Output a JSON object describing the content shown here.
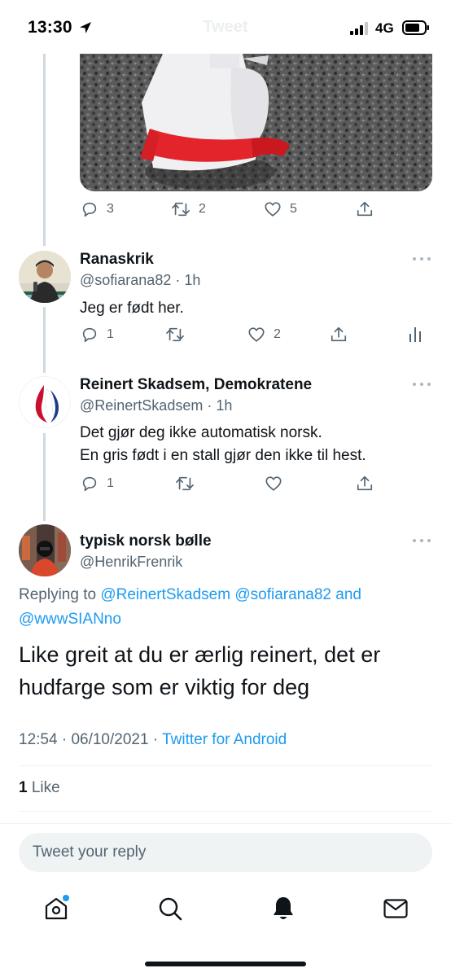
{
  "status_bar": {
    "time": "13:30",
    "network": "4G",
    "faded_title": "Tweet"
  },
  "colors": {
    "accent": "#1d9bf0",
    "text_primary": "#0f1419",
    "text_secondary": "#536471",
    "thread_line": "#cfd9de",
    "divider": "#eff3f4"
  },
  "parent_tweet": {
    "media_alt": "photo of a white megaphone with a red strap on gravel",
    "reply_count": "3",
    "retweet_count": "2",
    "like_count": "5",
    "icons": [
      "reply-icon",
      "retweet-icon",
      "like-icon",
      "share-icon"
    ]
  },
  "replies": [
    {
      "display_name": "Ranaskrik",
      "handle": "@sofiarana82",
      "time": "· 1h",
      "text_lines": [
        "Jeg er født her."
      ],
      "reply_count": "1",
      "retweet_count": "",
      "like_count": "2",
      "icons": [
        "reply-icon",
        "retweet-icon",
        "like-icon",
        "share-icon",
        "analytics-icon"
      ]
    },
    {
      "display_name": "Reinert Skadsem, Demokratene",
      "handle": "@ReinertSkadsem",
      "time": "· 1h",
      "text_lines": [
        "Det gjør deg ikke automatisk norsk.",
        "En gris født i en stall gjør den ikke til hest."
      ],
      "reply_count": "1",
      "retweet_count": "",
      "like_count": "",
      "icons": [
        "reply-icon",
        "retweet-icon",
        "like-icon",
        "share-icon"
      ]
    }
  ],
  "focused_tweet": {
    "display_name": "typisk norsk bølle",
    "handle": "@HenrikFrenrik",
    "replying_prefix": "Replying to ",
    "mention_1": "@ReinertSkadsem",
    "mention_2": "@sofiarana82",
    "mention_joiner": " and",
    "mention_3": "@wwwSIANno",
    "text": "Like greit at du er ærlig reinert, det er hudfarge som er viktig for deg",
    "time": "12:54",
    "separator": " · ",
    "date": "06/10/2021",
    "source": "Twitter for Android",
    "like_count": "1",
    "like_label": " Like"
  },
  "reply_bar": {
    "placeholder": "Tweet your reply"
  },
  "tab_bar": {
    "tabs": [
      "home-icon",
      "search-icon",
      "notifications-icon",
      "messages-icon"
    ],
    "home_has_notification_dot": true
  }
}
